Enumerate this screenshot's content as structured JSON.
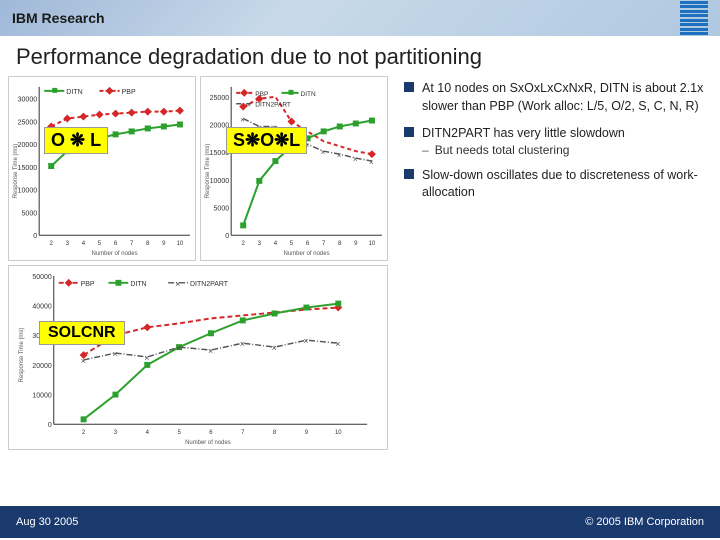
{
  "header": {
    "title": "IBM Research",
    "logo_alt": "IBM Logo"
  },
  "page_title": "Performance degradation due to not partitioning",
  "charts": {
    "top_left": {
      "label": "O ❋ L",
      "legends": [
        {
          "name": "DITN",
          "color": "#2ca02c",
          "style": "solid"
        },
        {
          "name": "PBP",
          "color": "#d62728",
          "style": "dashed"
        }
      ],
      "y_axis": "Response Time (ms)",
      "x_axis": "Number of nodes",
      "y_max": "35000"
    },
    "top_right": {
      "label": "S❋O❋L",
      "legends": [
        {
          "name": "PBP",
          "color": "#d62728",
          "style": "dashed"
        },
        {
          "name": "DITN",
          "color": "#2ca02c",
          "style": "solid"
        },
        {
          "name": "DITN2PART",
          "color": "#555",
          "style": "dot-dash"
        }
      ],
      "y_axis": "Response Time (ms)",
      "x_axis": "Number of nodes",
      "y_max": "40000"
    },
    "bottom": {
      "label": "SOLCNR",
      "legends": [
        {
          "name": "PBP",
          "color": "#d62728",
          "style": "dashed"
        },
        {
          "name": "DITN",
          "color": "#2ca02c",
          "style": "solid"
        },
        {
          "name": "DITN2PART",
          "color": "#555",
          "style": "dot-dash"
        }
      ],
      "y_axis": "Response Time (ms)",
      "x_axis": "Number of nodes",
      "y_max": "50000"
    }
  },
  "bullets": [
    {
      "text": "At 10 nodes on SxOxLxCxNxR, DITN is about 2.1x slower than PBP (Work alloc: L/5, O/2, S, C, N, R)"
    },
    {
      "text": "DITN2PART has very little slowdown",
      "sub": "But needs total clustering"
    },
    {
      "text": "Slow-down oscillates due to discreteness of work-allocation"
    }
  ],
  "footer": {
    "date": "Aug 30 2005",
    "copyright": "© 2005 IBM Corporation"
  }
}
